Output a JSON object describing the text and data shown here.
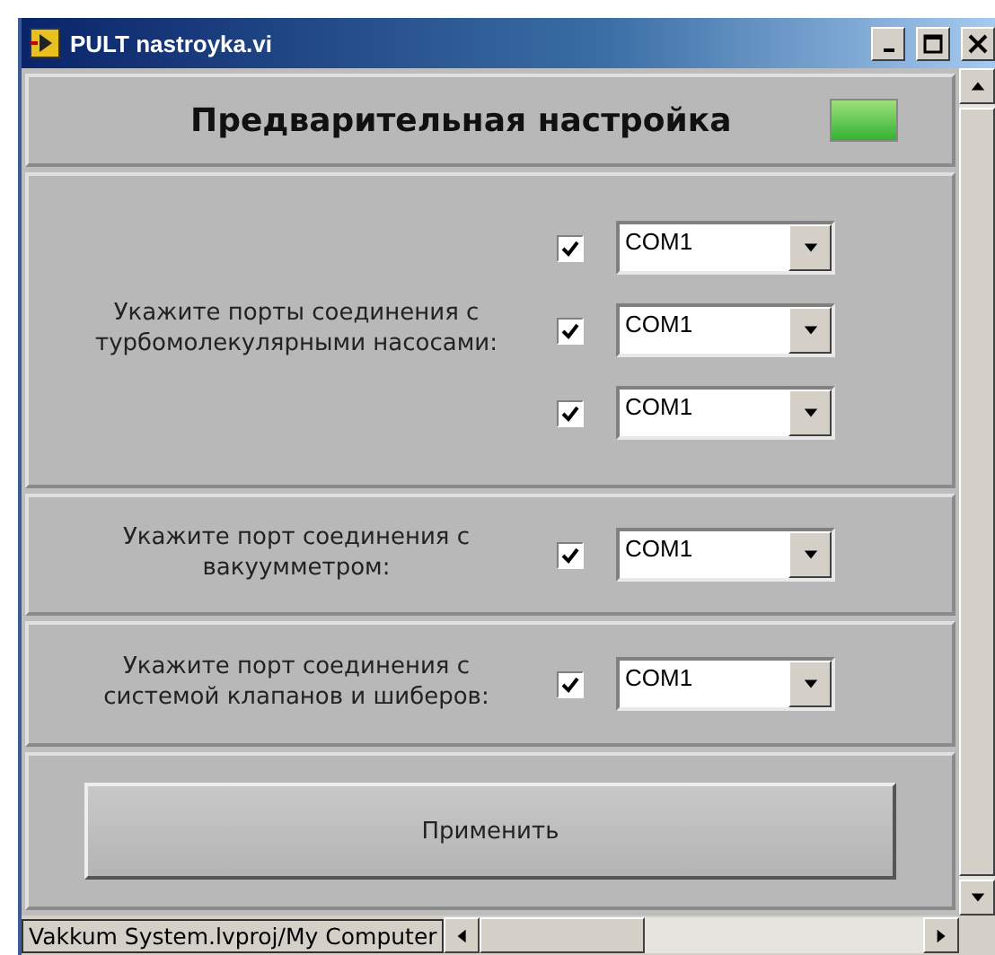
{
  "window": {
    "title": "PULT nastroyka.vi"
  },
  "header": {
    "title": "Предварительная настройка",
    "led_on": true
  },
  "sections": [
    {
      "label": "Укажите порты соединения с турбомолекулярными насосами:",
      "ports": [
        {
          "checked": true,
          "value": "COM1"
        },
        {
          "checked": true,
          "value": "COM1"
        },
        {
          "checked": true,
          "value": "COM1"
        }
      ]
    },
    {
      "label": "Укажите порт соединения с вакуумметром:",
      "ports": [
        {
          "checked": true,
          "value": "COM1"
        }
      ]
    },
    {
      "label": "Укажите порт соединения с системой клапанов и шиберов:",
      "ports": [
        {
          "checked": true,
          "value": "COM1"
        }
      ]
    }
  ],
  "apply_button": "Применить",
  "status_bar": {
    "path": "Vakkum System.lvproj/My Computer"
  }
}
